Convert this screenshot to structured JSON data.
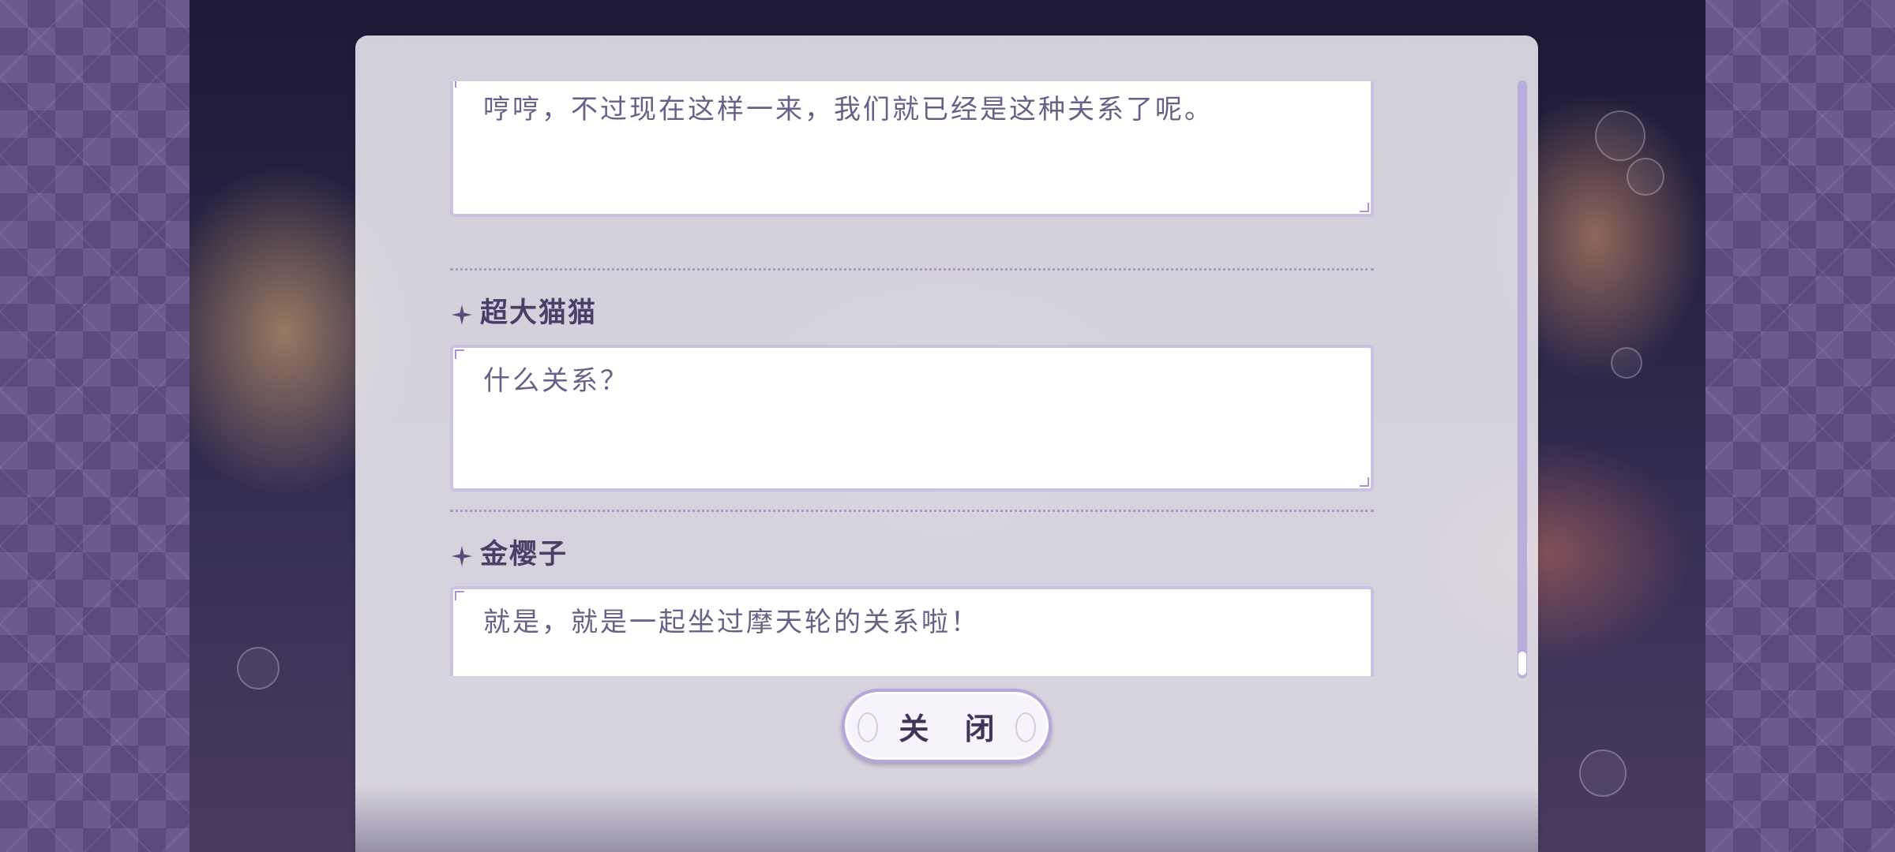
{
  "dialog_log": {
    "entries": [
      {
        "speaker": "",
        "text": "哼哼，不过现在这样一来，我们就已经是这种关系了呢。"
      },
      {
        "speaker": "超大猫猫",
        "text": "什么关系？"
      },
      {
        "speaker": "金樱子",
        "text": "就是，就是一起坐过摩天轮的关系啦！"
      }
    ]
  },
  "close_button": {
    "label": "关 闭"
  },
  "icons": {
    "speaker_marker": "sparkle-star-icon",
    "close_decoration": "ornament-icon"
  },
  "colors": {
    "panel_bg": "#f0edf5",
    "box_border": "#cbc1e3",
    "speaker_name": "#4b3f68",
    "speech_text": "#6a5f86",
    "side_pattern": "#6a5a8e"
  }
}
